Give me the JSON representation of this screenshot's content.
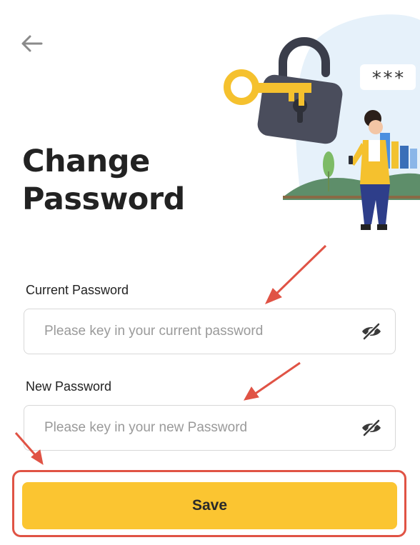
{
  "header": {
    "back_icon": "arrow-left-icon",
    "title_line1": "Change",
    "title_line2": "Password"
  },
  "illustration": {
    "password_mask": "***",
    "icons": [
      "padlock-icon",
      "key-icon",
      "person-illustration",
      "city-skyline"
    ]
  },
  "form": {
    "current_password": {
      "label": "Current Password",
      "value": "",
      "placeholder": "Please key in your current password",
      "toggle_icon": "eye-off-icon"
    },
    "new_password": {
      "label": "New Password",
      "value": "",
      "placeholder": "Please key in your new Password",
      "toggle_icon": "eye-off-icon"
    }
  },
  "actions": {
    "save_label": "Save"
  },
  "colors": {
    "accent": "#fbc531",
    "annotation": "#e05345",
    "background": "#ffffff",
    "border": "#d8d8d8"
  }
}
